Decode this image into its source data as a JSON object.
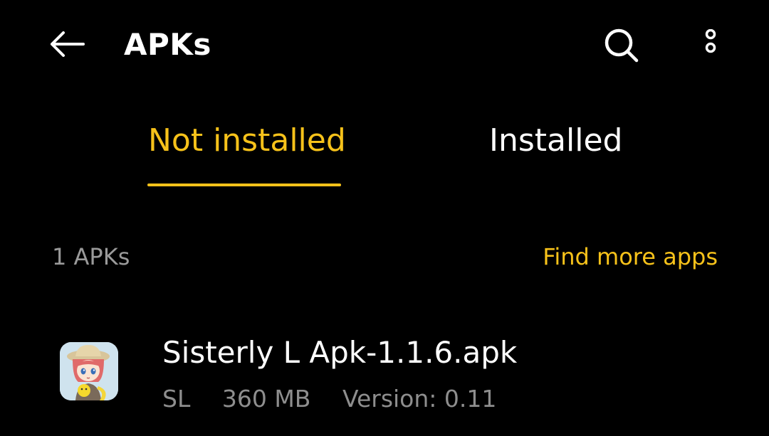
{
  "app_bar": {
    "title": "APKs",
    "back_icon": "arrow-left-icon",
    "search_icon": "search-icon",
    "more_icon": "more-vertical-icon"
  },
  "tabs": [
    {
      "label": "Not installed",
      "selected": true
    },
    {
      "label": "Installed",
      "selected": false
    }
  ],
  "list_header": {
    "count": "1 APKs",
    "action": "Find more apps"
  },
  "apks": [
    {
      "name": "Sisterly L Apk-1.1.6.apk",
      "short_name": "SL",
      "size": "360 MB",
      "version": "Version: 0.11",
      "icon": "app-icon-anime-girl"
    }
  ],
  "colors": {
    "background": "#000000",
    "accent": "#f7c21a",
    "primary_text": "#ffffff",
    "secondary_text": "#8e8e8e"
  }
}
